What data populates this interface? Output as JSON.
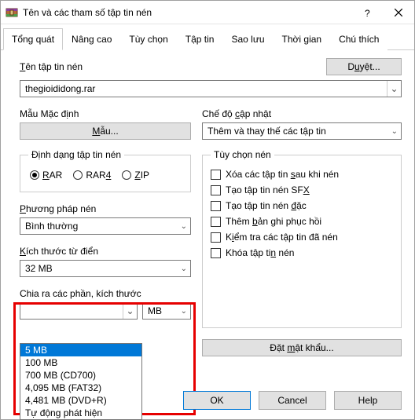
{
  "window": {
    "title": "Tên và các tham số tập tin nén"
  },
  "tabs": {
    "items": [
      {
        "label": "Tổng quát"
      },
      {
        "label": "Nâng cao"
      },
      {
        "label": "Tùy chọn"
      },
      {
        "label": "Tập tin"
      },
      {
        "label": "Sao lưu"
      },
      {
        "label": "Thời gian"
      },
      {
        "label": "Chú thích"
      }
    ]
  },
  "archive_name": {
    "label": "Tên tập tin nén",
    "value": "thegioididong.rar",
    "browse": "Duyệt..."
  },
  "profile": {
    "label": "Mẫu Mặc định",
    "button": "Mẫu..."
  },
  "update_mode": {
    "label": "Chế độ cập nhật",
    "value": "Thêm và thay thế các tập tin"
  },
  "format": {
    "legend": "Định dạng tập tin nén",
    "rar": "RAR",
    "rar4": "RAR4",
    "zip": "ZIP"
  },
  "method": {
    "label": "Phương pháp nén",
    "value": "Bình thường"
  },
  "dict": {
    "label": "Kích thước từ điển",
    "value": "32 MB"
  },
  "split": {
    "label": "Chia ra các phần, kích thước",
    "value": "",
    "unit": "MB",
    "options": [
      "5 MB",
      "100 MB",
      "700 MB  (CD700)",
      "4,095 MB  (FAT32)",
      "4,481 MB  (DVD+R)",
      "Tự động phát hiện"
    ]
  },
  "options": {
    "legend": "Tùy chọn nén",
    "delete_after": "Xóa các tập tin sau khi nén",
    "sfx": "Tạo tập tin nén SFX",
    "solid": "Tạo tập tin nén đặc",
    "recovery": "Thêm bản ghi phục hồi",
    "test": "Kiểm tra các tập tin đã nén",
    "lock": "Khóa tập tin nén"
  },
  "password_btn": "Đặt mật khẩu...",
  "footer": {
    "ok": "OK",
    "cancel": "Cancel",
    "help": "Help"
  }
}
